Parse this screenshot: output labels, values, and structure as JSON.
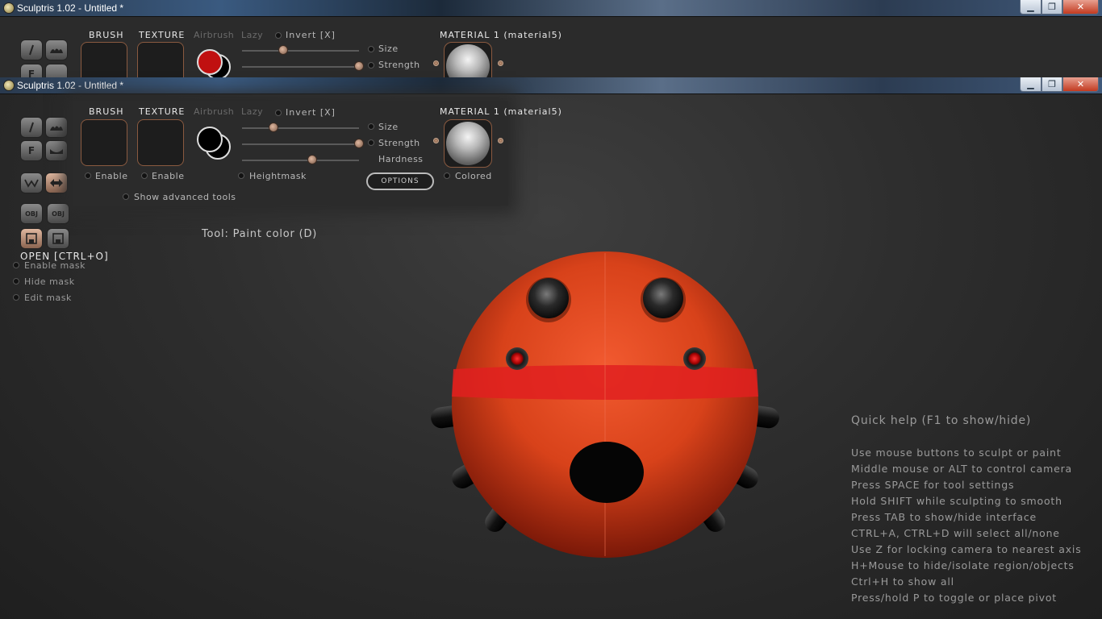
{
  "window": {
    "title": "Sculptris 1.02 - Untitled *"
  },
  "panel": {
    "brush_label": "BRUSH",
    "texture_label": "TEXTURE",
    "airbrush_label": "Airbrush",
    "lazy_label": "Lazy",
    "invert_label": "Invert [X]",
    "size_label": "Size",
    "strength_label": "Strength",
    "hardness_label": "Hardness",
    "material_label": "MATERIAL 1 (material5)",
    "enable_brush_label": "Enable",
    "enable_texture_label": "Enable",
    "heightmask_label": "Heightmask",
    "options_label": "OPTIONS",
    "colored_label": "Colored",
    "advanced_label": "Show advanced tools",
    "size_value": 0.27,
    "strength_value": 1.0,
    "hardness_value": 0.6,
    "top_size_value": 0.35,
    "top_strength_value": 1.0
  },
  "colors": {
    "top_paint": "#c01010",
    "paint": "#000000"
  },
  "tool_status": "Tool: Paint color (D)",
  "open_label": "OPEN [CTRL+O]",
  "mask": {
    "enable_label": "Enable mask",
    "hide_label": "Hide mask",
    "edit_label": "Edit mask"
  },
  "quickhelp": {
    "title": "Quick help (F1 to show/hide)",
    "lines": [
      "Use mouse buttons to sculpt or paint",
      "Middle mouse or ALT to control camera",
      "Press SPACE for tool settings",
      "Hold SHIFT while sculpting to smooth",
      "Press TAB to show/hide interface",
      "CTRL+A, CTRL+D will select all/none",
      "Use Z for locking camera to nearest axis",
      "H+Mouse to hide/isolate region/objects",
      "Ctrl+H to show all",
      "Press/hold P to toggle or place pivot"
    ]
  }
}
